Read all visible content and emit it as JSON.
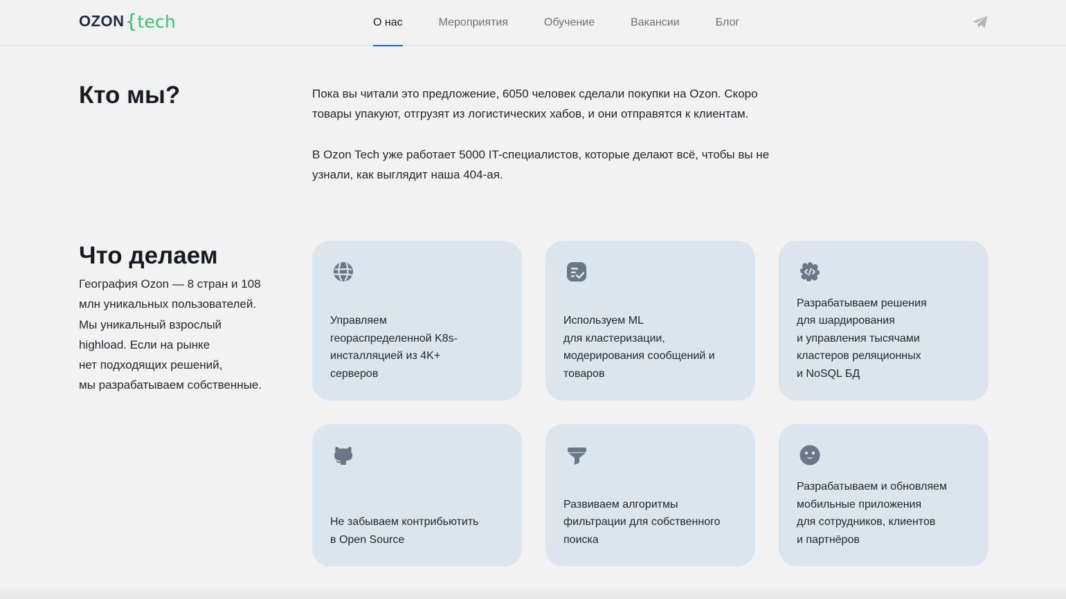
{
  "header": {
    "logo": {
      "ozon": "OZON",
      "brace": "{",
      "tech": "tech"
    },
    "nav": [
      {
        "label": "О нас",
        "active": true
      },
      {
        "label": "Мероприятия",
        "active": false
      },
      {
        "label": "Обучение",
        "active": false
      },
      {
        "label": "Вакансии",
        "active": false
      },
      {
        "label": "Блог",
        "active": false
      }
    ],
    "telegram_icon": "telegram-icon"
  },
  "who": {
    "title": "Кто мы?",
    "paragraphs": [
      "Пока вы читали это предложение, 6050 человек сделали покупки на Ozon. Скоро товары упакуют, отгрузят из логистических хабов, и они отправятся к клиентам.",
      "В Ozon Tech уже работает 5000 IT-специалистов, которые делают всё, чтобы вы не узнали, как выглядит наша 404-ая."
    ]
  },
  "what": {
    "title": "Что делаем",
    "description": "География Ozon — 8 стран и 108\nмлн уникальных пользователей.\nМы уникальный взрослый\nhighload. Если на рынке\nнет подходящих решений,\nмы разрабатываем собственные.",
    "cards": [
      {
        "icon": "globe-icon",
        "text": "Управляем\nгеораспределенной K8s-\nинсталляцией из 4K+\nсерверов"
      },
      {
        "icon": "document-check-icon",
        "text": "Используем ML\nдля кластеризации,\nмодерирования сообщений и\nтоваров"
      },
      {
        "icon": "code-gear-icon",
        "text": "Разрабатываем решения\nдля шардирования\nи управления тысячами\nкластеров реляционных\nи NoSQL БД"
      },
      {
        "icon": "github-icon",
        "text": "Не забываем контрибьютить\nв Open Source"
      },
      {
        "icon": "filter-icon",
        "text": "Развиваем алгоритмы\nфильтрации для собственного\nпоиска"
      },
      {
        "icon": "smiley-icon",
        "text": "Разрабатываем и обновляем\nмобильные приложения\nдля сотрудников, клиентов\nи партнёров"
      }
    ]
  },
  "colors": {
    "background": "#f2f2f2",
    "card": "#dbe5ee",
    "accent": "#1e5fdc",
    "logo_green": "#32c36c",
    "icon": "#6b7686"
  }
}
